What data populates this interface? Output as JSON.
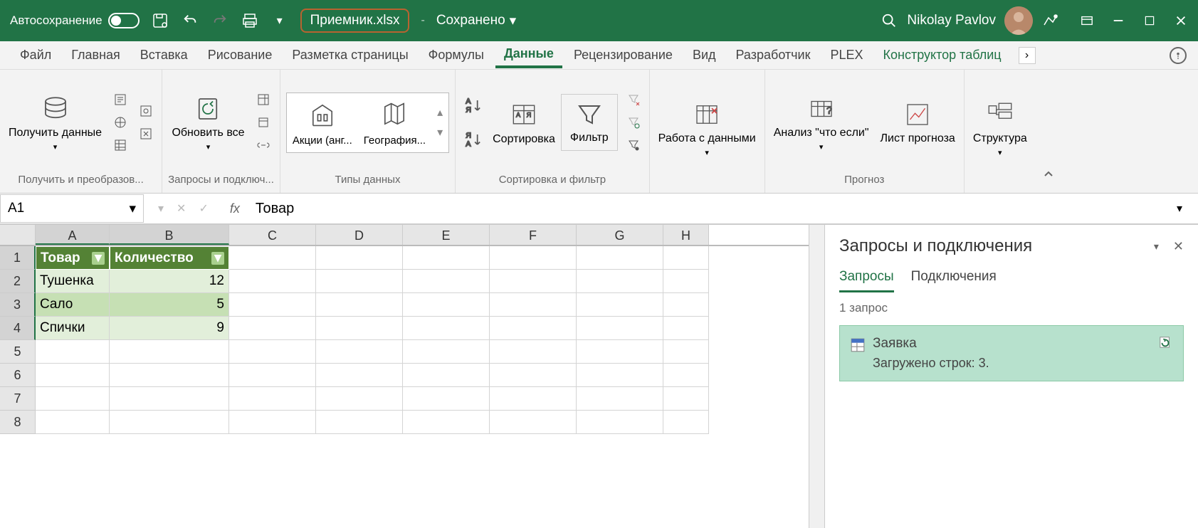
{
  "titlebar": {
    "autosave": "Автосохранение",
    "filename": "Приемник.xlsx",
    "saved": "Сохранено",
    "user": "Nikolay Pavlov"
  },
  "tabs": [
    "Файл",
    "Главная",
    "Вставка",
    "Рисование",
    "Разметка страницы",
    "Формулы",
    "Данные",
    "Рецензирование",
    "Вид",
    "Разработчик",
    "PLEX",
    "Конструктор таблиц"
  ],
  "active_tab": "Данные",
  "ribbon": {
    "get_data": "Получить данные",
    "get_transform": "Получить и преобразов...",
    "refresh_all": "Обновить все",
    "queries_conn": "Запросы и подключ...",
    "stocks": "Акции (анг...",
    "geography": "География...",
    "data_types": "Типы данных",
    "sort": "Сортировка",
    "filter": "Фильтр",
    "sort_filter": "Сортировка и фильтр",
    "data_tools": "Работа с данными",
    "what_if": "Анализ \"что если\"",
    "forecast_sheet": "Лист прогноза",
    "forecast": "Прогноз",
    "outline": "Структура"
  },
  "formula": {
    "name_box": "A1",
    "value": "Товар"
  },
  "columns": [
    "A",
    "B",
    "C",
    "D",
    "E",
    "F",
    "G",
    "H"
  ],
  "rows": [
    1,
    2,
    3,
    4,
    5,
    6,
    7,
    8
  ],
  "table": {
    "header": [
      "Товар",
      "Количество"
    ],
    "rows": [
      [
        "Тушенка",
        "12"
      ],
      [
        "Сало",
        "5"
      ],
      [
        "Спички",
        "9"
      ]
    ]
  },
  "panel": {
    "title": "Запросы и подключения",
    "tab_queries": "Запросы",
    "tab_connections": "Подключения",
    "count": "1 запрос",
    "query_name": "Заявка",
    "query_status": "Загружено строк: 3."
  }
}
